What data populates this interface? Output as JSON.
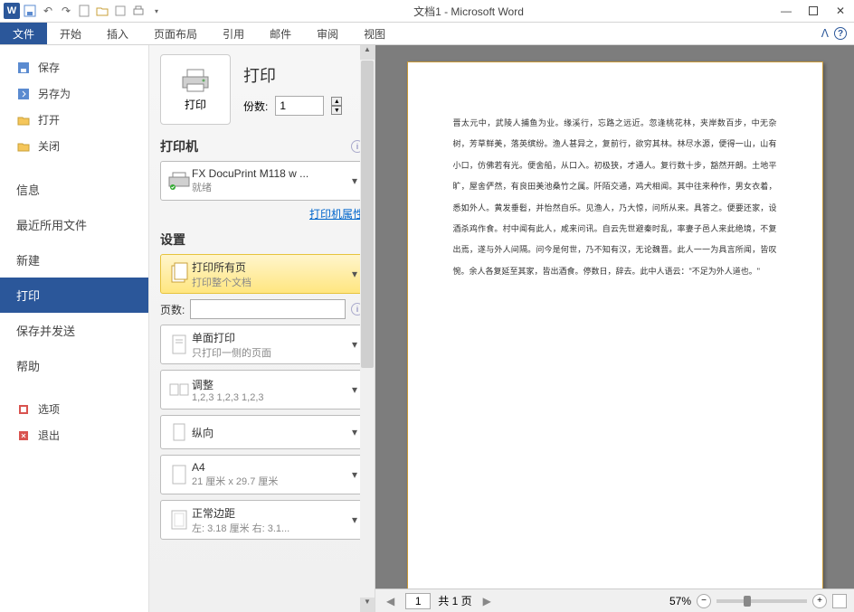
{
  "titlebar": {
    "title": "文档1 - Microsoft Word",
    "word_mark": "W"
  },
  "ribbon": {
    "tabs": [
      "文件",
      "开始",
      "插入",
      "页面布局",
      "引用",
      "邮件",
      "审阅",
      "视图"
    ],
    "active_index": 0
  },
  "sidebar": {
    "save": "保存",
    "save_as": "另存为",
    "open": "打开",
    "close": "关闭",
    "info": "信息",
    "recent": "最近所用文件",
    "new": "新建",
    "print": "打印",
    "save_send": "保存并发送",
    "help": "帮助",
    "options": "选项",
    "exit": "退出"
  },
  "print": {
    "hero_title": "打印",
    "hero_btn_label": "打印",
    "copies_label": "份数:",
    "copies_value": "1",
    "printer_section": "打印机",
    "printer_name": "FX DocuPrint M118 w ...",
    "printer_status": "就绪",
    "printer_props": "打印机属性",
    "settings_section": "设置",
    "scope_title": "打印所有页",
    "scope_sub": "打印整个文档",
    "pages_label": "页数:",
    "pages_value": "",
    "duplex_title": "单面打印",
    "duplex_sub": "只打印一侧的页面",
    "collate_title": "调整",
    "collate_sub": "1,2,3   1,2,3   1,2,3",
    "orient_title": "纵向",
    "size_title": "A4",
    "size_sub": "21 厘米 x 29.7 厘米",
    "margin_title": "正常边距",
    "margin_sub": "左: 3.18 厘米   右: 3.1..."
  },
  "preview": {
    "page_current": "1",
    "page_total_label": "共 1 页",
    "zoom_label": "57%",
    "body_lines": [
      "晋太元中，武陵人捕鱼为业。缘溪行，忘路之远近。忽逢桃花林，夹岸数百步，中无杂树，",
      "芳草鲜美，落英缤纷。渔人甚异之，复前行，欲穷其林。",
      "林尽水源，便得一山，山有小口，仿佛若有光。便舍船，从口入。初极狭，才通人。复行数",
      "十步，豁然开朗。土地平旷，屋舍俨然，有良田美池桑竹之属。阡陌交通，鸡犬相闻。其中",
      "往来种作，男女衣着，悉如外人。黄发垂髫，并怡然自乐。",
      "见渔人，乃大惊，问所从来。具答之。便要还家，设酒杀鸡作食。村中闻有此人，咸来问讯。",
      "自云先世避秦时乱，率妻子邑人来此绝境，不复出焉，遂与外人间隔。问今是何世，乃不知",
      "有汉，无论魏晋。此人一一为具言所闻，皆叹惋。余人各复延至其家，皆出酒食。停数日，",
      "辞去。此中人语云：\"不足为外人道也。\""
    ]
  }
}
